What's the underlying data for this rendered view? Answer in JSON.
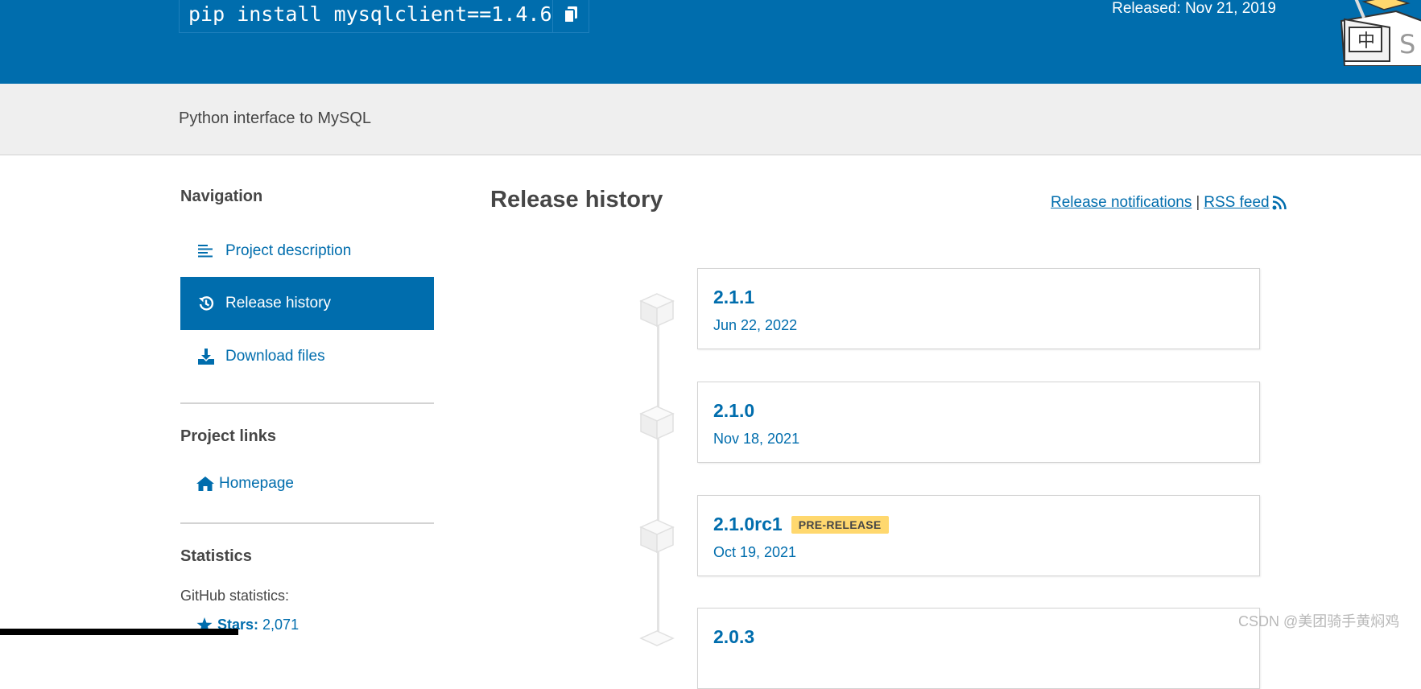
{
  "header": {
    "pip_command": "pip install mysqlclient==1.4.6",
    "released": "Released: Nov 21, 2019",
    "copy_icon": "copy-icon"
  },
  "summary": "Python interface to MySQL",
  "sidebar": {
    "navigation_heading": "Navigation",
    "nav_items": [
      {
        "label": "Project description",
        "icon": "align-left-icon",
        "active": false
      },
      {
        "label": "Release history",
        "icon": "history-icon",
        "active": true
      },
      {
        "label": "Download files",
        "icon": "download-icon",
        "active": false
      }
    ],
    "project_links_heading": "Project links",
    "homepage_label": "Homepage",
    "statistics_heading": "Statistics",
    "github_stats_label": "GitHub statistics:",
    "stars_label": "Stars:",
    "stars_value": "2,071"
  },
  "main": {
    "title": "Release history",
    "notifications_link": "Release notifications",
    "separator": "|",
    "rss_link": "RSS feed",
    "releases": [
      {
        "version": "2.1.1",
        "date": "Jun 22, 2022",
        "badge": ""
      },
      {
        "version": "2.1.0",
        "date": "Nov 18, 2021",
        "badge": ""
      },
      {
        "version": "2.1.0rc1",
        "date": "Oct 19, 2021",
        "badge": "PRE-RELEASE"
      },
      {
        "version": "2.0.3",
        "date": "",
        "badge": ""
      }
    ]
  },
  "watermark": "CSDN @美团骑手黄焖鸡",
  "colors": {
    "brand": "#006dad",
    "badge": "#ffd86e",
    "summary_bg": "#efefef"
  }
}
